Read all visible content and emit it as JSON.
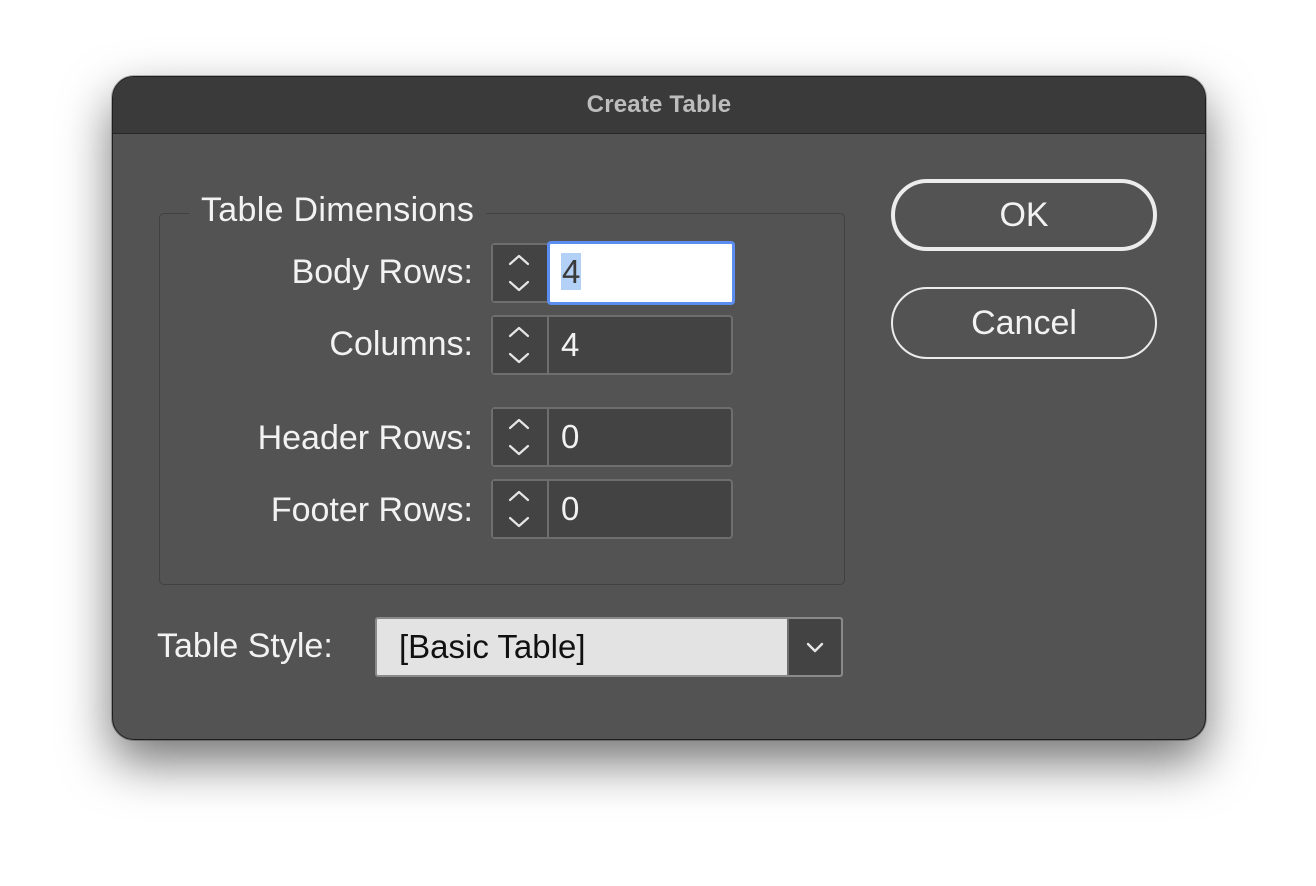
{
  "window": {
    "title": "Create Table"
  },
  "dimensions": {
    "legend": "Table Dimensions",
    "body_rows": {
      "label": "Body Rows:",
      "value": "4",
      "focused": true
    },
    "columns": {
      "label": "Columns:",
      "value": "4"
    },
    "header_rows": {
      "label": "Header Rows:",
      "value": "0"
    },
    "footer_rows": {
      "label": "Footer Rows:",
      "value": "0"
    }
  },
  "buttons": {
    "ok_label": "OK",
    "cancel_label": "Cancel"
  },
  "table_style": {
    "label": "Table Style:",
    "selected": "[Basic Table]"
  },
  "icons": {
    "stepper": "up-down-chevron-icon",
    "dropdown": "chevron-down-icon"
  },
  "colors": {
    "dialog_bg": "#535353",
    "titlebar_bg": "#3a3a3a",
    "focus_ring": "#5b8ef0",
    "selection": "#b3d1f7"
  }
}
